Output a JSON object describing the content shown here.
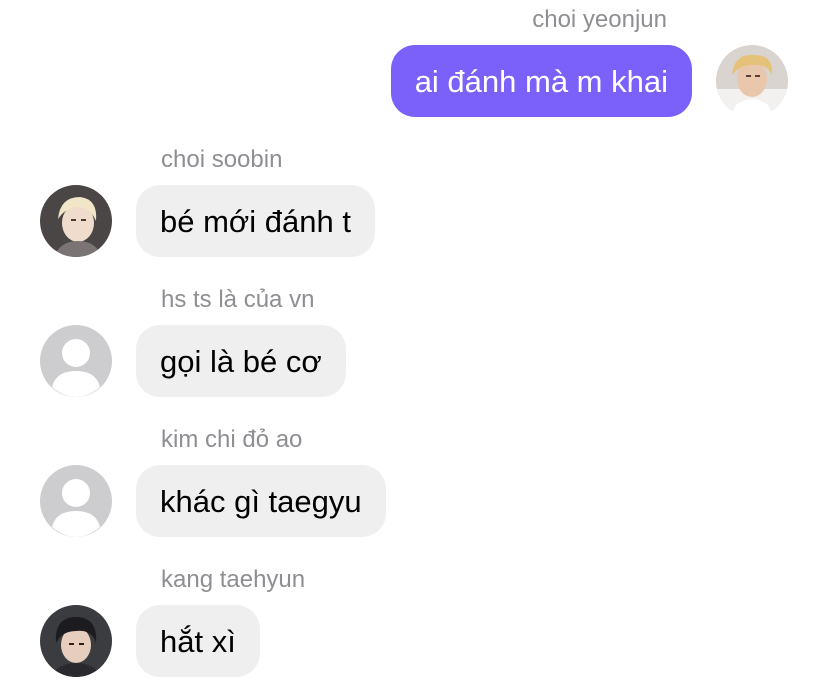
{
  "messages": [
    {
      "sender": "choi yeonjun",
      "text": "ai đánh mà m khai",
      "direction": "outgoing",
      "avatar": "photo-avatar-blond"
    },
    {
      "sender": "choi soobin",
      "text": "bé mới đánh t",
      "direction": "incoming",
      "avatar": "photo-avatar-light-hair"
    },
    {
      "sender": "hs ts là của vn",
      "text": "gọi là bé cơ",
      "direction": "incoming",
      "avatar": "default-user-icon"
    },
    {
      "sender": "kim chi đỏ ao",
      "text": "khác gì taegyu",
      "direction": "incoming",
      "avatar": "default-user-icon"
    },
    {
      "sender": "kang taehyun",
      "text": "hắt xì",
      "direction": "incoming",
      "avatar": "photo-avatar-dark-hair"
    }
  ],
  "colors": {
    "outgoing_bubble": "#7b61f9",
    "incoming_bubble": "#efeff0",
    "sender_name": "#8e8e93",
    "default_avatar_bg": "#cdcdd0"
  }
}
